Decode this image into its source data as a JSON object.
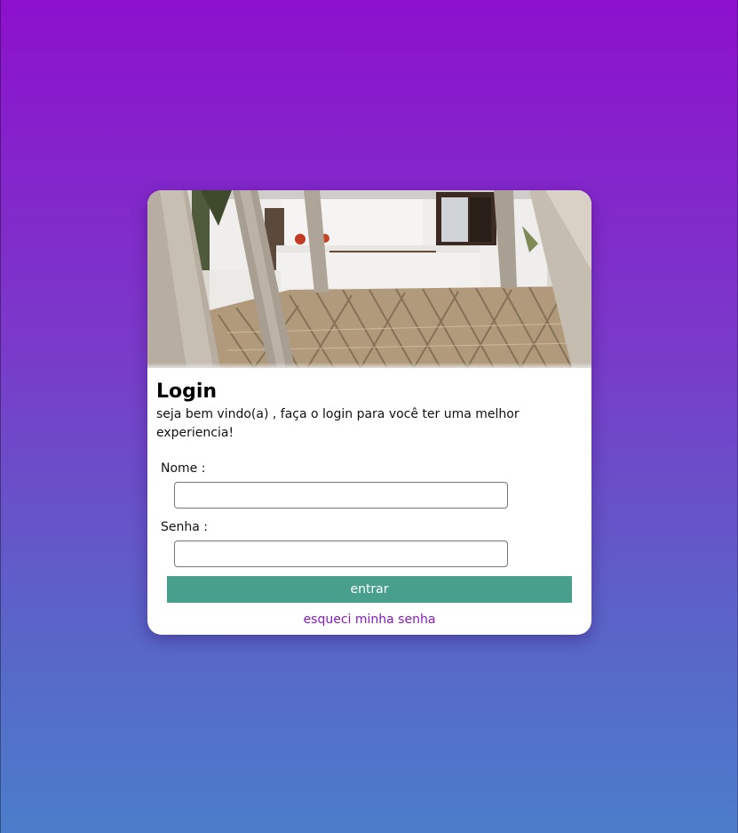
{
  "login": {
    "title": "Login",
    "subtitle": "seja bem vindo(a) , faça o login para você ter uma melhor experiencia!",
    "name_label": "Nome :",
    "name_value": "",
    "password_label": "Senha :",
    "password_value": "",
    "submit_label": "entrar",
    "forgot_link": "esqueci minha senha"
  },
  "colors": {
    "background_top": "#8d11cd",
    "background_bottom": "#4b7dca",
    "card": "#ffffff",
    "button": "#48a08c",
    "link": "#8718c8"
  },
  "hero": {
    "icon": "beach-house-photo"
  }
}
